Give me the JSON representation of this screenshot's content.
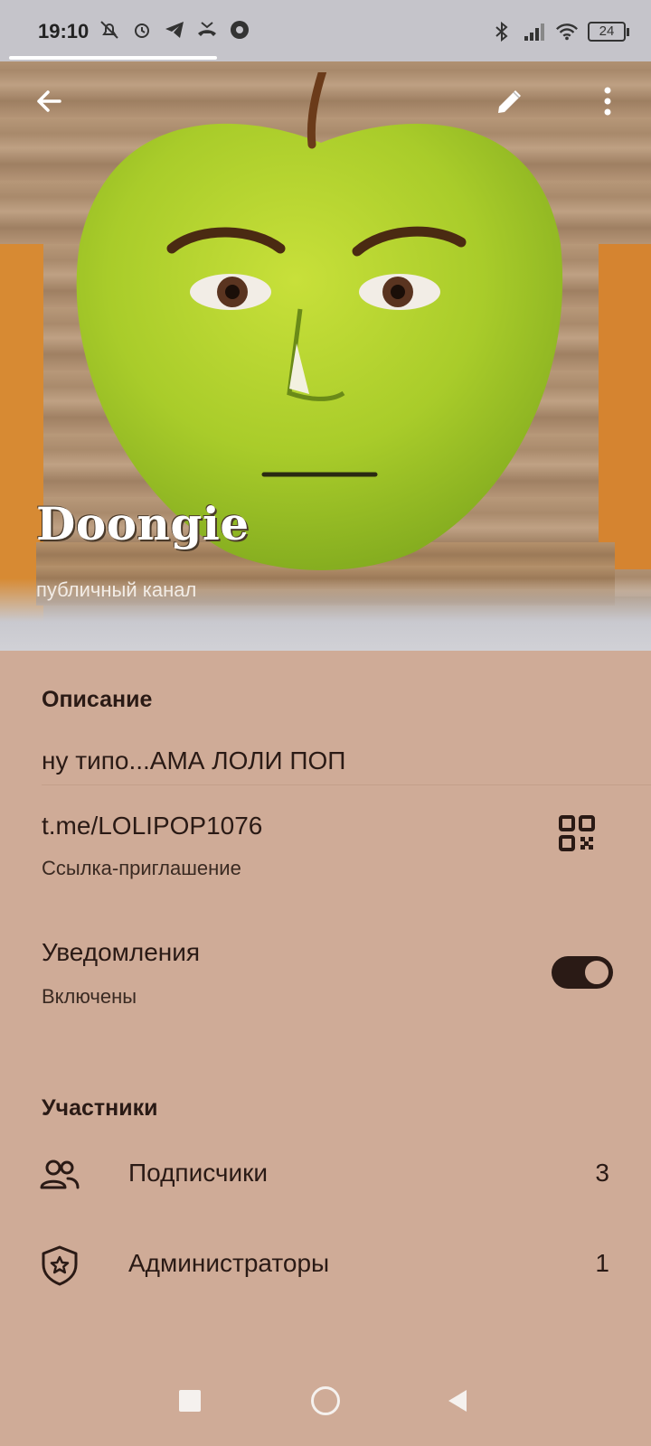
{
  "status_bar": {
    "time": "19:10",
    "left_icons": [
      "bell-off-icon",
      "alarm-icon",
      "telegram-icon",
      "missed-call-icon",
      "chrome-icon"
    ],
    "right_icons": [
      "bluetooth-icon",
      "signal-icon",
      "wifi-icon",
      "battery-icon"
    ],
    "battery": "24"
  },
  "header": {
    "channel_name": "Doongie",
    "channel_type": "публичный канал",
    "back_icon": "arrow-left-icon",
    "edit_icon": "pencil-icon",
    "menu_icon": "more-vertical-icon"
  },
  "description": {
    "title": "Описание",
    "text": "ну типо...АМА ЛОЛИ ПОП"
  },
  "invite_link": {
    "link": "t.me/LOLIPOP1076",
    "caption": "Ссылка-приглашение",
    "icon": "qr-code-icon"
  },
  "notifications": {
    "title": "Уведомления",
    "status": "Включены",
    "enabled": true
  },
  "members": {
    "title": "Участники",
    "items": [
      {
        "label": "Подписчики",
        "count": "3",
        "icon": "people-icon"
      },
      {
        "label": "Администраторы",
        "count": "1",
        "icon": "admin-shield-icon"
      }
    ]
  },
  "nav_bar": {
    "buttons": [
      "recents-square-icon",
      "home-circle-icon",
      "back-triangle-icon"
    ]
  },
  "colors": {
    "background": "#cfab97",
    "text": "#2a1a15",
    "apple_green": "#a9cc2a"
  }
}
